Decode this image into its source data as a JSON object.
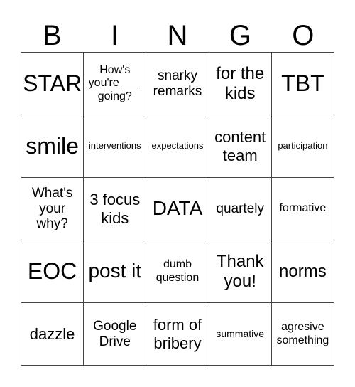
{
  "header": [
    "B",
    "I",
    "N",
    "G",
    "O"
  ],
  "cells": [
    [
      "STAR",
      "How's you're ___ going?",
      "snarky remarks",
      "for the kids",
      "TBT"
    ],
    [
      "smile",
      "interventions",
      "expectations",
      "content team",
      "participation"
    ],
    [
      "What's your why?",
      "3 focus kids",
      "DATA",
      "quartely",
      "formative"
    ],
    [
      "EOC",
      "post it",
      "dumb question",
      "Thank you!",
      "norms"
    ],
    [
      "dazzle",
      "Google Drive",
      "form of bribery",
      "summative",
      "agresive something"
    ]
  ]
}
